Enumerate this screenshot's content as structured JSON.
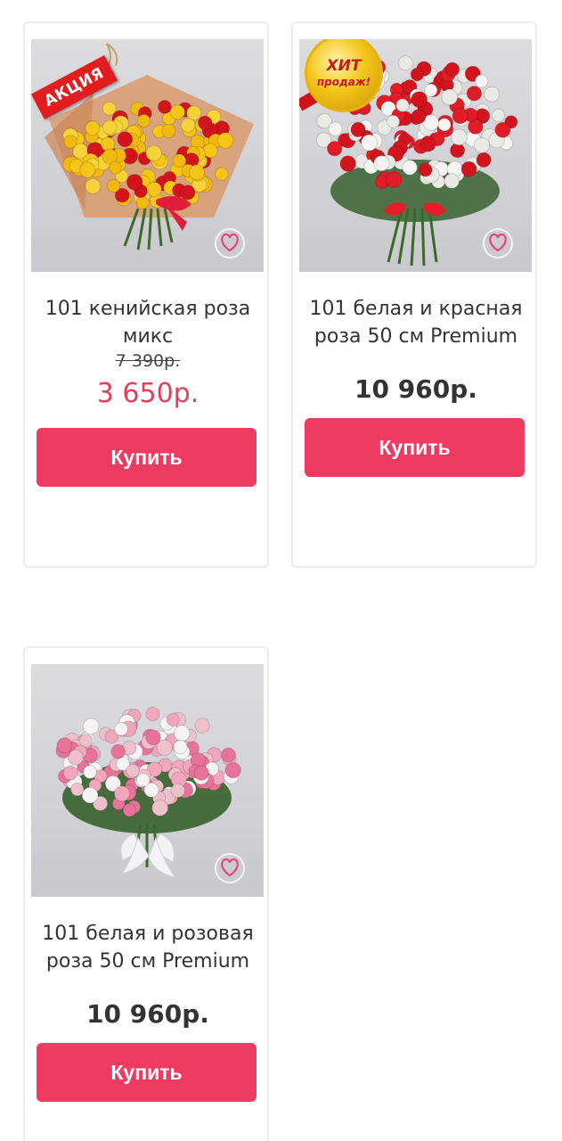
{
  "products": [
    {
      "title": "101 кенийская роза микс",
      "old_price": "7 390р.",
      "price": "3 650р.",
      "badge": "АКЦИЯ",
      "buy_label": "Купить"
    },
    {
      "title": "101 белая и красная роза 50 см Premium",
      "price": "10 960р.",
      "badge_line1": "ХИТ",
      "badge_line2": "продаж!",
      "buy_label": "Купить"
    },
    {
      "title": "101 белая и розовая роза 50 см Premium",
      "price": "10 960р.",
      "buy_label": "Купить"
    }
  ],
  "colors": {
    "accent": "#ef3a62",
    "sale_price": "#e43f5a",
    "text": "#333333"
  },
  "icons": [
    "heart-rose-logo-icon"
  ]
}
